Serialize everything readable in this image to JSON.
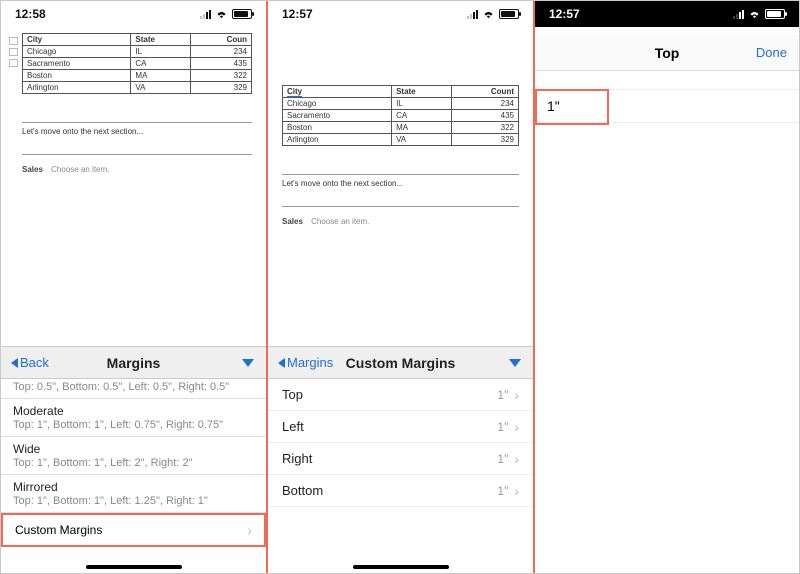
{
  "pane1": {
    "time": "12:58",
    "table": {
      "headers": [
        "City",
        "State",
        "Count"
      ],
      "head_cut": "Coun",
      "rows": [
        [
          "Chicago",
          "IL",
          "234"
        ],
        [
          "Sacramento",
          "CA",
          "435"
        ],
        [
          "Boston",
          "MA",
          "322"
        ],
        [
          "Arlington",
          "VA",
          "329"
        ]
      ]
    },
    "doc_text": "Let's move onto the next section...",
    "sales_label": "Sales",
    "sales_hint": "Choose an item.",
    "back_label": "Back",
    "panel_title": "Margins",
    "cut_desc": "Top: 0.5\", Bottom: 0.5\", Left: 0.5\", Right: 0.5\"",
    "presets": [
      {
        "label": "Moderate",
        "desc": "Top: 1\", Bottom: 1\", Left: 0.75\", Right: 0.75\""
      },
      {
        "label": "Wide",
        "desc": "Top: 1\", Bottom: 1\", Left: 2\", Right: 2\""
      },
      {
        "label": "Mirrored",
        "desc": "Top: 1\", Bottom: 1\", Left: 1.25\", Right: 1\""
      }
    ],
    "custom_label": "Custom Margins"
  },
  "pane2": {
    "time": "12:57",
    "back_label": "Margins",
    "panel_title": "Custom Margins",
    "rows": [
      {
        "label": "Top",
        "value": "1\""
      },
      {
        "label": "Left",
        "value": "1\""
      },
      {
        "label": "Right",
        "value": "1\""
      },
      {
        "label": "Bottom",
        "value": "1\""
      }
    ]
  },
  "pane3": {
    "time": "12:57",
    "title": "Top",
    "done": "Done",
    "value": "1\""
  },
  "chart_data": {
    "type": "table",
    "columns": [
      "City",
      "State",
      "Count"
    ],
    "rows": [
      [
        "Chicago",
        "IL",
        234
      ],
      [
        "Sacramento",
        "CA",
        435
      ],
      [
        "Boston",
        "MA",
        322
      ],
      [
        "Arlington",
        "VA",
        329
      ]
    ]
  }
}
